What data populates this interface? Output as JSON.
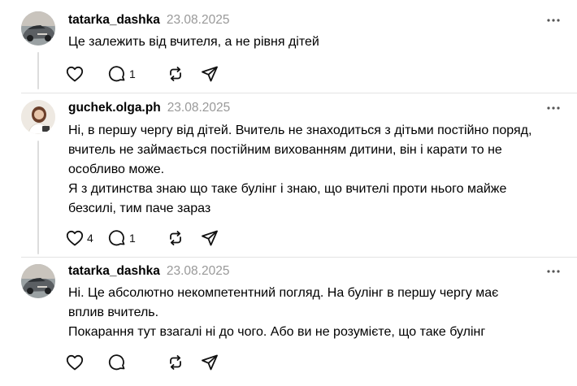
{
  "posts": [
    {
      "username": "tatarka_dashka",
      "date": "23.08.2025",
      "lines": [
        "Це залежить від вчителя, а не рівня дітей"
      ],
      "likes": "",
      "replies": "1",
      "avatar": "car-photo-avatar"
    },
    {
      "username": "guchek.olga.ph",
      "date": "23.08.2025",
      "lines": [
        "Ні, в першу чергу від дітей. Вчитель не знаходиться з дітьми постійно поряд,",
        "вчитель не займається постійним вихованням дитини, він і карати то не",
        "особливо може.",
        "Я з дитинства знаю що таке булінг і знаю, що вчителі проти нього майже",
        "безсилі, тим паче зараз"
      ],
      "likes": "4",
      "replies": "1",
      "avatar": "woman-photo-avatar"
    },
    {
      "username": "tatarka_dashka",
      "date": "23.08.2025",
      "lines": [
        "Ні. Це абсолютно некомпетентний погляд. На булінг в першу чергу має",
        "вплив вчитель.",
        "Покарання тут взагалі ні до чого. Або ви не розумієте, що таке булінг"
      ],
      "likes": "",
      "replies": "",
      "avatar": "car-photo-avatar"
    }
  ],
  "icons": {
    "like": "heart-icon",
    "reply": "comment-icon",
    "repost": "repost-icon",
    "share": "send-icon",
    "more": "more-dots-icon"
  },
  "colors": {
    "text": "#000000",
    "muted": "#999999",
    "divider": "#e3e3e3",
    "thread_line": "#dddddd"
  }
}
